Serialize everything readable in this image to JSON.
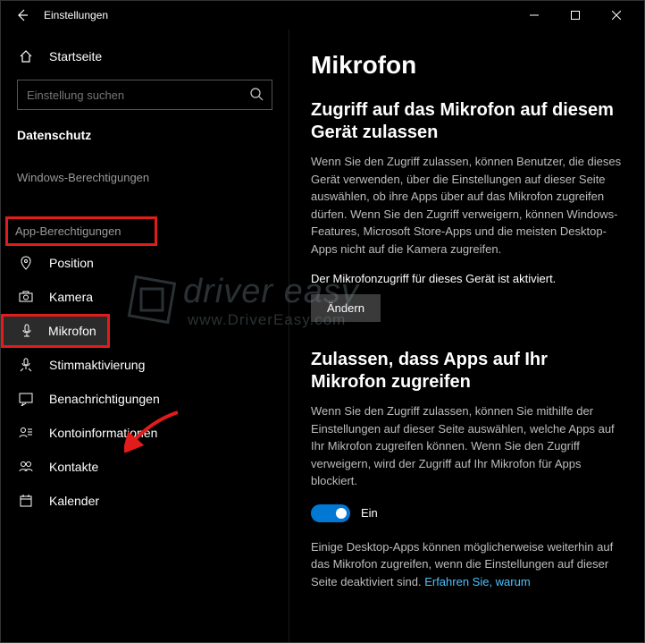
{
  "window": {
    "title": "Einstellungen"
  },
  "sidebar": {
    "home": "Startseite",
    "searchPlaceholder": "Einstellung suchen",
    "category": "Datenschutz",
    "group1": "Windows-Berechtigungen",
    "group2": "App-Berechtigungen",
    "items": {
      "position": "Position",
      "kamera": "Kamera",
      "mikrofon": "Mikrofon",
      "stimme": "Stimmaktivierung",
      "benach": "Benachrichtigungen",
      "konto": "Kontoinformationen",
      "kontakte": "Kontakte",
      "kalender": "Kalender"
    }
  },
  "main": {
    "title": "Mikrofon",
    "sec1h": "Zugriff auf das Mikrofon auf diesem Gerät zulassen",
    "sec1p": "Wenn Sie den Zugriff zulassen, können Benutzer, die dieses Gerät verwenden, über die Einstellungen auf dieser Seite auswählen, ob ihre Apps über auf das Mikrofon zugreifen dürfen. Wenn Sie den Zugriff verweigern, können Windows-Features, Microsoft Store-Apps und die meisten Desktop-Apps nicht auf die Kamera zugreifen.",
    "status": "Der Mikrofonzugriff für dieses Gerät ist aktiviert.",
    "changeBtn": "Ändern",
    "sec2h": "Zulassen, dass Apps auf Ihr Mikrofon zugreifen",
    "sec2p": "Wenn Sie den Zugriff zulassen, können Sie mithilfe der Einstellungen auf dieser Seite auswählen, welche Apps auf Ihr Mikrofon zugreifen können. Wenn Sie den Zugriff verweigern, wird der Zugriff auf Ihr Mikrofon für Apps blockiert.",
    "toggleLabel": "Ein",
    "sec3p1": "Einige Desktop-Apps können möglicherweise weiterhin auf das Mikrofon zugreifen, wenn die Einstellungen auf dieser Seite deaktiviert sind. ",
    "sec3link": "Erfahren Sie, warum"
  },
  "watermark": {
    "line1": "driver easy",
    "line2": "www.DriverEasy.com"
  }
}
